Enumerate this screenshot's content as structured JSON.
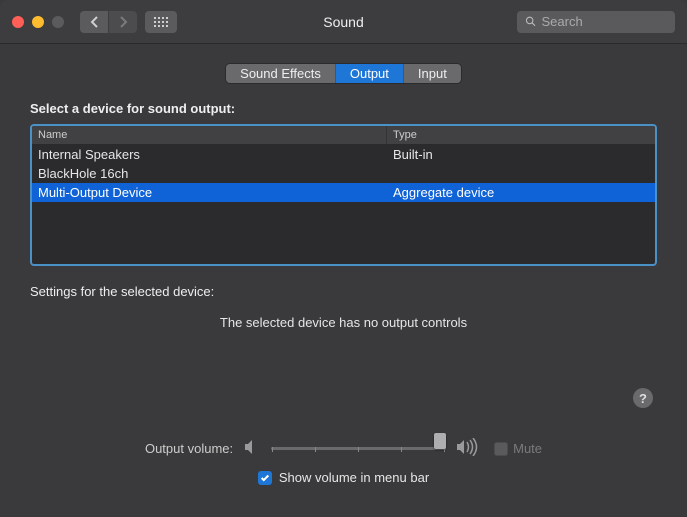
{
  "window": {
    "title": "Sound"
  },
  "search": {
    "placeholder": "Search"
  },
  "tabs": {
    "sound_effects": "Sound Effects",
    "output": "Output",
    "input": "Input",
    "active": "output"
  },
  "select_label": "Select a device for sound output:",
  "columns": {
    "name": "Name",
    "type": "Type"
  },
  "devices": [
    {
      "name": "Internal Speakers",
      "type": "Built-in",
      "selected": false
    },
    {
      "name": "BlackHole 16ch",
      "type": "",
      "selected": false
    },
    {
      "name": "Multi-Output Device",
      "type": "Aggregate device",
      "selected": true
    }
  ],
  "settings_label": "Settings for the selected device:",
  "no_controls": "The selected device has no output controls",
  "volume": {
    "label": "Output volume:",
    "value_percent": 100,
    "mute_label": "Mute",
    "mute_checked": false
  },
  "show_menu": {
    "label": "Show volume in menu bar",
    "checked": true
  }
}
